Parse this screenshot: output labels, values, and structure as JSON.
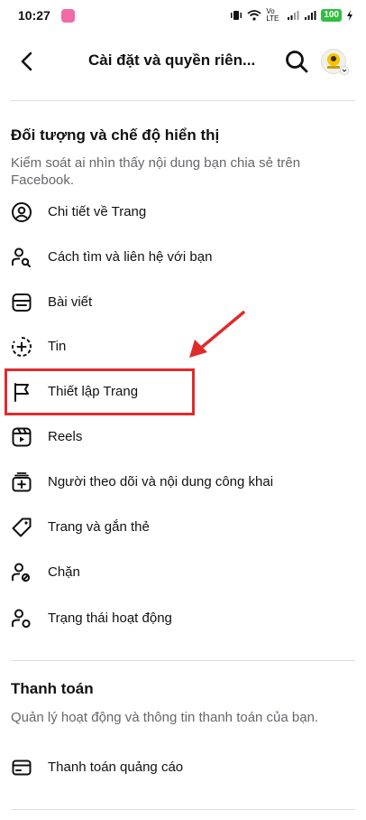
{
  "status_bar": {
    "time": "10:27",
    "network_label": "Vo LTE",
    "battery": "100"
  },
  "header": {
    "title": "Cài đặt và quyền riên..."
  },
  "audience_section": {
    "title": "Đối tượng và chế độ hiển thị",
    "description": "Kiểm soát ai nhìn thấy nội dung bạn chia sẻ trên Facebook.",
    "items": [
      {
        "label": "Chi tiết về Trang",
        "icon": "person-circle-icon"
      },
      {
        "label": "Cách tìm và liên hệ với bạn",
        "icon": "person-search-icon"
      },
      {
        "label": "Bài viết",
        "icon": "post-icon"
      },
      {
        "label": "Tin",
        "icon": "story-add-icon"
      },
      {
        "label": "Thiết lập Trang",
        "icon": "flag-icon"
      },
      {
        "label": "Reels",
        "icon": "reels-icon"
      },
      {
        "label": "Người theo dõi và nội dung công khai",
        "icon": "followers-icon"
      },
      {
        "label": "Trang và gắn thẻ",
        "icon": "tag-icon"
      },
      {
        "label": "Chặn",
        "icon": "person-block-icon"
      },
      {
        "label": "Trạng thái hoạt động",
        "icon": "person-status-icon"
      }
    ]
  },
  "payments_section": {
    "title": "Thanh toán",
    "description": "Quản lý hoạt động và thông tin thanh toán của bạn.",
    "items": [
      {
        "label": "Thanh toán quảng cáo",
        "icon": "credit-card-icon"
      }
    ]
  },
  "colors": {
    "annotation_red": "#e02b2b",
    "secondary_text": "#65676b",
    "divider": "#dadde1"
  }
}
